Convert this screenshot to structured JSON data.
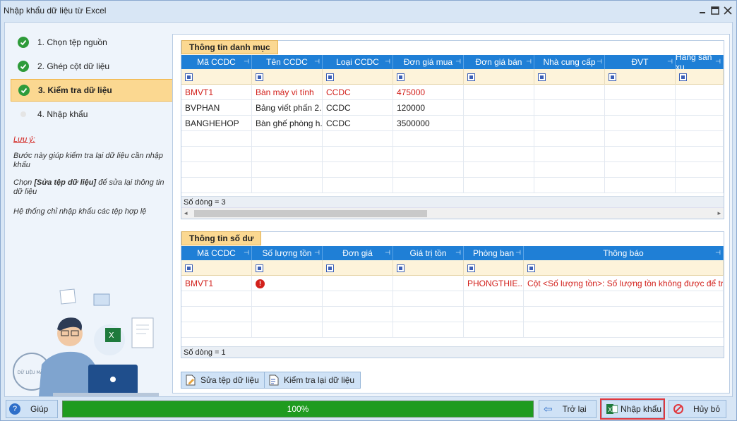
{
  "window": {
    "title": "Nhập khẩu dữ liệu từ Excel"
  },
  "steps": [
    {
      "label": "1. Chọn tệp nguồn",
      "state": "done"
    },
    {
      "label": "2. Ghép cột dữ liệu",
      "state": "done"
    },
    {
      "label": "3. Kiểm tra dữ liệu",
      "state": "active"
    },
    {
      "label": "4. Nhập khẩu",
      "state": "pending"
    }
  ],
  "notes": {
    "heading": "Lưu ý:",
    "line1": "Bước này giúp kiểm tra lại dữ liệu cần nhập khẩu",
    "line2_prefix": "Chọn ",
    "line2_bold": "[Sửa tệp dữ liệu]",
    "line2_suffix": " để sửa lại thông tin dữ liệu",
    "line3": "Hệ thống chỉ nhập khẩu các tệp hợp lệ"
  },
  "illustration": {
    "stamp": "DỮ LIỆU MẪU"
  },
  "catalog": {
    "tab": "Thông tin danh mục",
    "columns": [
      "Mã CCDC",
      "Tên CCDC",
      "Loại CCDC",
      "Đơn giá mua",
      "Đơn giá bán",
      "Nhà cung cấp",
      "ĐVT",
      "Hãng sản xu"
    ],
    "rows": [
      {
        "error": true,
        "cells": [
          "BMVT1",
          "Bàn máy vi tính",
          "CCDC",
          "475000",
          "",
          "",
          "",
          ""
        ]
      },
      {
        "error": false,
        "cells": [
          "BVPHAN",
          "Bảng viết phấn 2...",
          "CCDC",
          "120000",
          "",
          "",
          "",
          ""
        ]
      },
      {
        "error": false,
        "cells": [
          "BANGHEHOP",
          "Bàn ghế phòng h...",
          "CCDC",
          "3500000",
          "",
          "",
          "",
          ""
        ]
      }
    ],
    "count": "Số dòng = 3"
  },
  "balance": {
    "tab": "Thông tin số dư",
    "columns": [
      "Mã CCDC",
      "Số lượng tồn",
      "Đơn giá",
      "Giá trị tồn",
      "Phòng ban",
      "Thông báo"
    ],
    "rows": [
      {
        "error": true,
        "cells": [
          "BMVT1",
          "",
          "",
          "",
          "PHONGTHIE...",
          "Cột <Số lượng tồn>: Số lượng tồn không được để trống."
        ]
      }
    ],
    "count": "Số dòng = 1"
  },
  "actions": {
    "edit": "Sửa tệp dữ liệu",
    "recheck": "Kiểm tra lại dữ liệu"
  },
  "footer": {
    "help": "Giúp",
    "progress_label": "100%",
    "progress": 1.0,
    "back": "Trở lại",
    "import": "Nhập khẩu",
    "cancel": "Hủy bỏ"
  },
  "colors": {
    "header_blue": "#1f7fd6",
    "active_step": "#fbd891",
    "progress_green": "#1f9b1f",
    "error_red": "#d2201b"
  }
}
